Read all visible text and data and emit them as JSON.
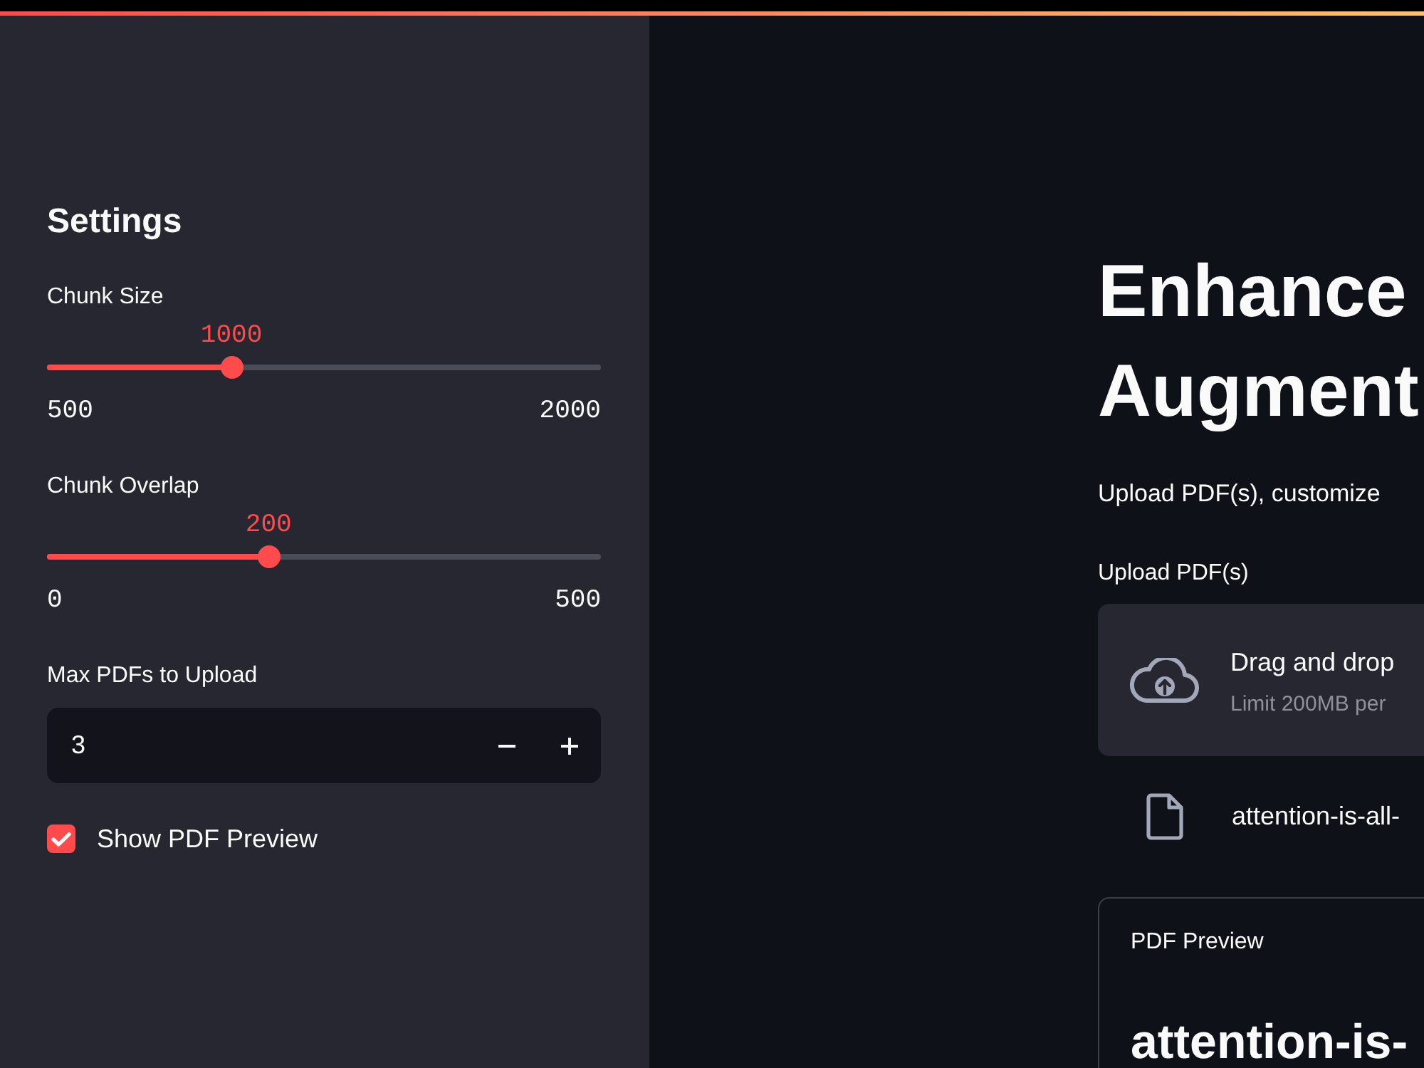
{
  "sidebar": {
    "title": "Settings",
    "sliders": [
      {
        "label": "Chunk Size",
        "value": "1000",
        "min": "500",
        "max": "2000",
        "level": 0.333
      },
      {
        "label": "Chunk Overlap",
        "value": "200",
        "min": "0",
        "max": "500",
        "level": 0.4
      }
    ],
    "number_input": {
      "label": "Max PDFs to Upload",
      "value": "3"
    },
    "checkbox": {
      "label": "Show PDF Preview",
      "checked": true
    }
  },
  "main": {
    "title_lines": [
      "Enhance",
      "Augment"
    ],
    "subtitle": "Upload PDF(s), customize",
    "uploader": {
      "label": "Upload PDF(s)",
      "dropzone_text": "Drag and drop",
      "limit_text": "Limit 200MB per"
    },
    "files": [
      {
        "name": "attention-is-all-"
      }
    ],
    "preview": {
      "label": "PDF Preview",
      "heading": "attention-is-"
    }
  }
}
